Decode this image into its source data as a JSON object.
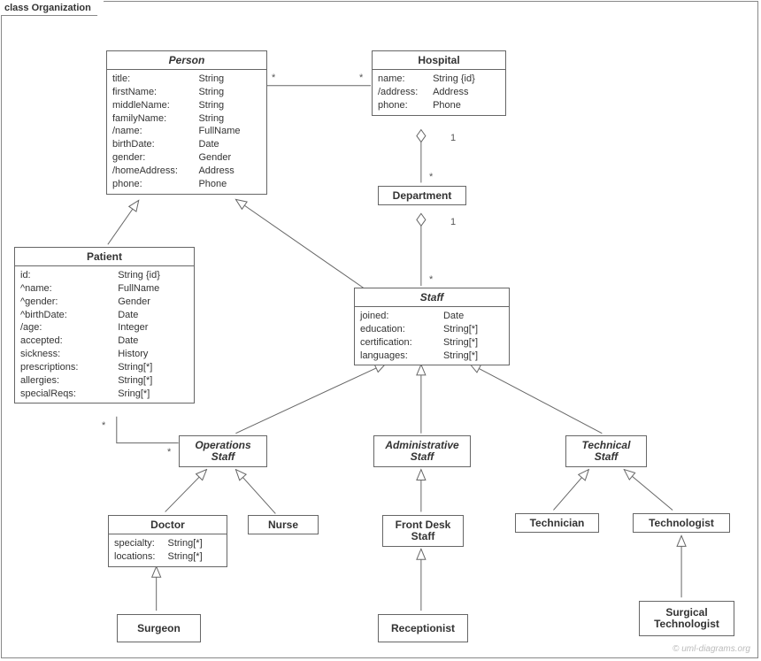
{
  "frame": {
    "label": "class Organization"
  },
  "watermark": "© uml-diagrams.org",
  "classes": {
    "person": {
      "name": "Person",
      "attrs": [
        {
          "name": "title:",
          "type": "String"
        },
        {
          "name": "firstName:",
          "type": "String"
        },
        {
          "name": "middleName:",
          "type": "String"
        },
        {
          "name": "familyName:",
          "type": "String"
        },
        {
          "name": "/name:",
          "type": "FullName"
        },
        {
          "name": "birthDate:",
          "type": "Date"
        },
        {
          "name": "gender:",
          "type": "Gender"
        },
        {
          "name": "/homeAddress:",
          "type": "Address"
        },
        {
          "name": "phone:",
          "type": "Phone"
        }
      ]
    },
    "hospital": {
      "name": "Hospital",
      "attrs": [
        {
          "name": "name:",
          "type": "String {id}"
        },
        {
          "name": "/address:",
          "type": "Address"
        },
        {
          "name": "phone:",
          "type": "Phone"
        }
      ]
    },
    "department": {
      "name": "Department"
    },
    "patient": {
      "name": "Patient",
      "attrs": [
        {
          "name": "id:",
          "type": "String {id}"
        },
        {
          "name": "^name:",
          "type": "FullName"
        },
        {
          "name": "^gender:",
          "type": "Gender"
        },
        {
          "name": "^birthDate:",
          "type": "Date"
        },
        {
          "name": "/age:",
          "type": "Integer"
        },
        {
          "name": "accepted:",
          "type": "Date"
        },
        {
          "name": "sickness:",
          "type": "History"
        },
        {
          "name": "prescriptions:",
          "type": "String[*]"
        },
        {
          "name": "allergies:",
          "type": "String[*]"
        },
        {
          "name": "specialReqs:",
          "type": "Sring[*]"
        }
      ]
    },
    "staff": {
      "name": "Staff",
      "attrs": [
        {
          "name": "joined:",
          "type": "Date"
        },
        {
          "name": "education:",
          "type": "String[*]"
        },
        {
          "name": "certification:",
          "type": "String[*]"
        },
        {
          "name": "languages:",
          "type": "String[*]"
        }
      ]
    },
    "opsStaff": {
      "name1": "Operations",
      "name2": "Staff"
    },
    "adminStaff": {
      "name1": "Administrative",
      "name2": "Staff"
    },
    "techStaff": {
      "name1": "Technical",
      "name2": "Staff"
    },
    "doctor": {
      "name": "Doctor",
      "attrs": [
        {
          "name": "specialty:",
          "type": "String[*]"
        },
        {
          "name": "locations:",
          "type": "String[*]"
        }
      ]
    },
    "nurse": {
      "name": "Nurse"
    },
    "frontDesk": {
      "name1": "Front Desk",
      "name2": "Staff"
    },
    "technician": {
      "name": "Technician"
    },
    "technologist": {
      "name": "Technologist"
    },
    "surgeon": {
      "name": "Surgeon"
    },
    "receptionist": {
      "name": "Receptionist"
    },
    "surgTech": {
      "name1": "Surgical",
      "name2": "Technologist"
    }
  },
  "mult": {
    "personHospital_p": "*",
    "personHospital_h": "*",
    "hospDept_h": "1",
    "hospDept_d": "*",
    "deptStaff_d": "1",
    "deptStaff_s": "*",
    "patientOps_p": "*",
    "patientOps_o": "*"
  }
}
